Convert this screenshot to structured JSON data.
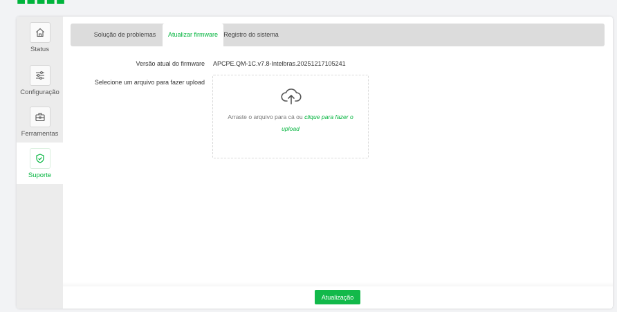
{
  "nav": [
    {
      "id": "status",
      "label": "Status",
      "icon": "home-icon",
      "active": false
    },
    {
      "id": "config",
      "label": "Configuração",
      "icon": "sliders-icon",
      "active": false
    },
    {
      "id": "tools",
      "label": "Ferramentas",
      "icon": "toolbox-icon",
      "active": false
    },
    {
      "id": "support",
      "label": "Suporte",
      "icon": "shield-check-icon",
      "active": true
    }
  ],
  "tabs": [
    {
      "label": "Solução de problemas",
      "active": false
    },
    {
      "label": "Atualizar firmware",
      "active": true
    },
    {
      "label": "Registro do sistema",
      "active": false
    }
  ],
  "firmware": {
    "current_label": "Versão atual do firmware",
    "current_value": "APCPE.QM-1C.v7.8-Intelbras.20251217105241",
    "upload_label": "Selecione um arquivo para fazer upload",
    "drop_text": "Arraste o arquivo para cá ou ",
    "drop_link": "clique para fazer o upload"
  },
  "footer": {
    "update_label": "Atualização"
  },
  "colors": {
    "accent": "#00b43c",
    "button": "#12b94a",
    "sidebar": "#ececec",
    "tabbar": "#dcdcdc"
  }
}
